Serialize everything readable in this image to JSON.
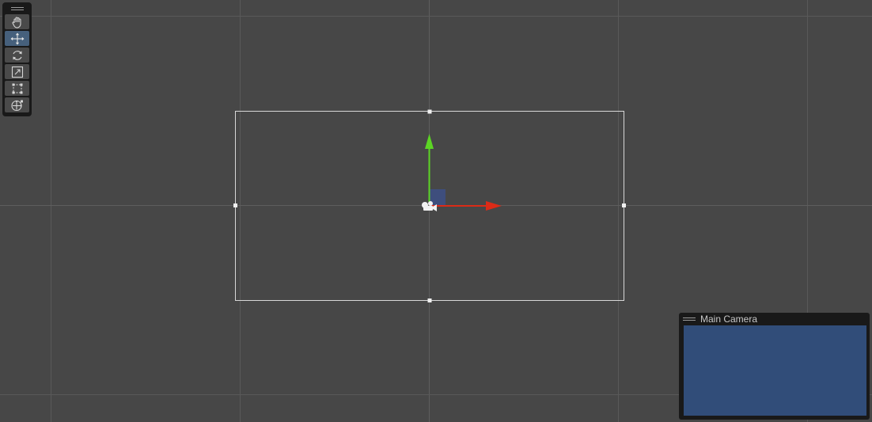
{
  "tools": {
    "items": [
      {
        "name": "hand-tool",
        "icon": "hand-icon",
        "active": false
      },
      {
        "name": "move-tool",
        "icon": "move-arrows-icon",
        "active": true
      },
      {
        "name": "rotate-tool",
        "icon": "rotate-icon",
        "active": false
      },
      {
        "name": "scale-tool",
        "icon": "scale-icon",
        "active": false
      },
      {
        "name": "rect-tool",
        "icon": "rect-transform-icon",
        "active": false
      },
      {
        "name": "transform-tool",
        "icon": "transform-icon",
        "active": false
      }
    ]
  },
  "camera_preview": {
    "title": "Main Camera",
    "background_color": "#314d79"
  },
  "colors": {
    "scene_background": "#474747",
    "grid_line": "#5a5a5a",
    "gizmo_x_axis": "#db2b17",
    "gizmo_y_axis": "#5cd524",
    "gizmo_plane_handle": "#3e4e7d",
    "active_tool": "#46607c"
  }
}
